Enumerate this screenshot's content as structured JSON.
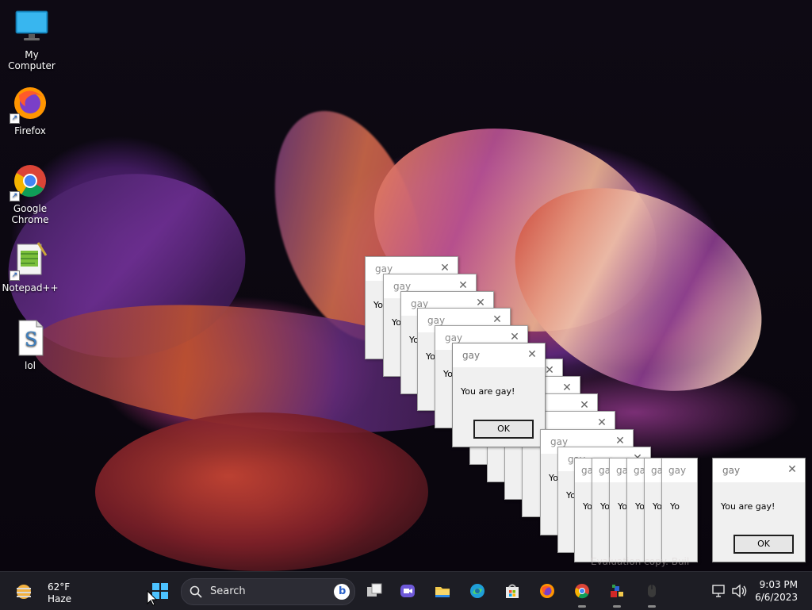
{
  "desktop": {
    "icons": [
      {
        "label": "My Computer"
      },
      {
        "label": "Firefox"
      },
      {
        "label": "Google Chrome"
      },
      {
        "label": "Notepad++"
      },
      {
        "label": "lol"
      }
    ],
    "watermark": "Evaluation copy. Buil"
  },
  "dialogs": {
    "title": "gay",
    "message": "You are gay!",
    "message_partial": "Yo",
    "ok_label": "OK",
    "ok_partial": "O",
    "close_icon": "close-icon"
  },
  "taskbar": {
    "weather": {
      "temp": "62°F",
      "condition": "Haze",
      "icon": "weather-haze-icon"
    },
    "start_icon": "windows-start-icon",
    "search": {
      "label": "Search"
    },
    "apps": [
      {
        "name": "task-view-icon"
      },
      {
        "name": "meet-icon"
      },
      {
        "name": "file-explorer-icon"
      },
      {
        "name": "edge-icon"
      },
      {
        "name": "store-icon"
      },
      {
        "name": "firefox-icon"
      },
      {
        "name": "chrome-icon"
      },
      {
        "name": "wizard-app-icon"
      },
      {
        "name": "mouse-app-icon"
      }
    ],
    "tray": {
      "network_icon": "network-icon",
      "volume_icon": "volume-icon"
    },
    "clock": {
      "time": "9:03 PM",
      "date": "6/6/2023"
    }
  },
  "colors": {
    "taskbar": "#1d1d24",
    "dialog_bg": "#f0f0f0",
    "accent": "#0078d4"
  }
}
